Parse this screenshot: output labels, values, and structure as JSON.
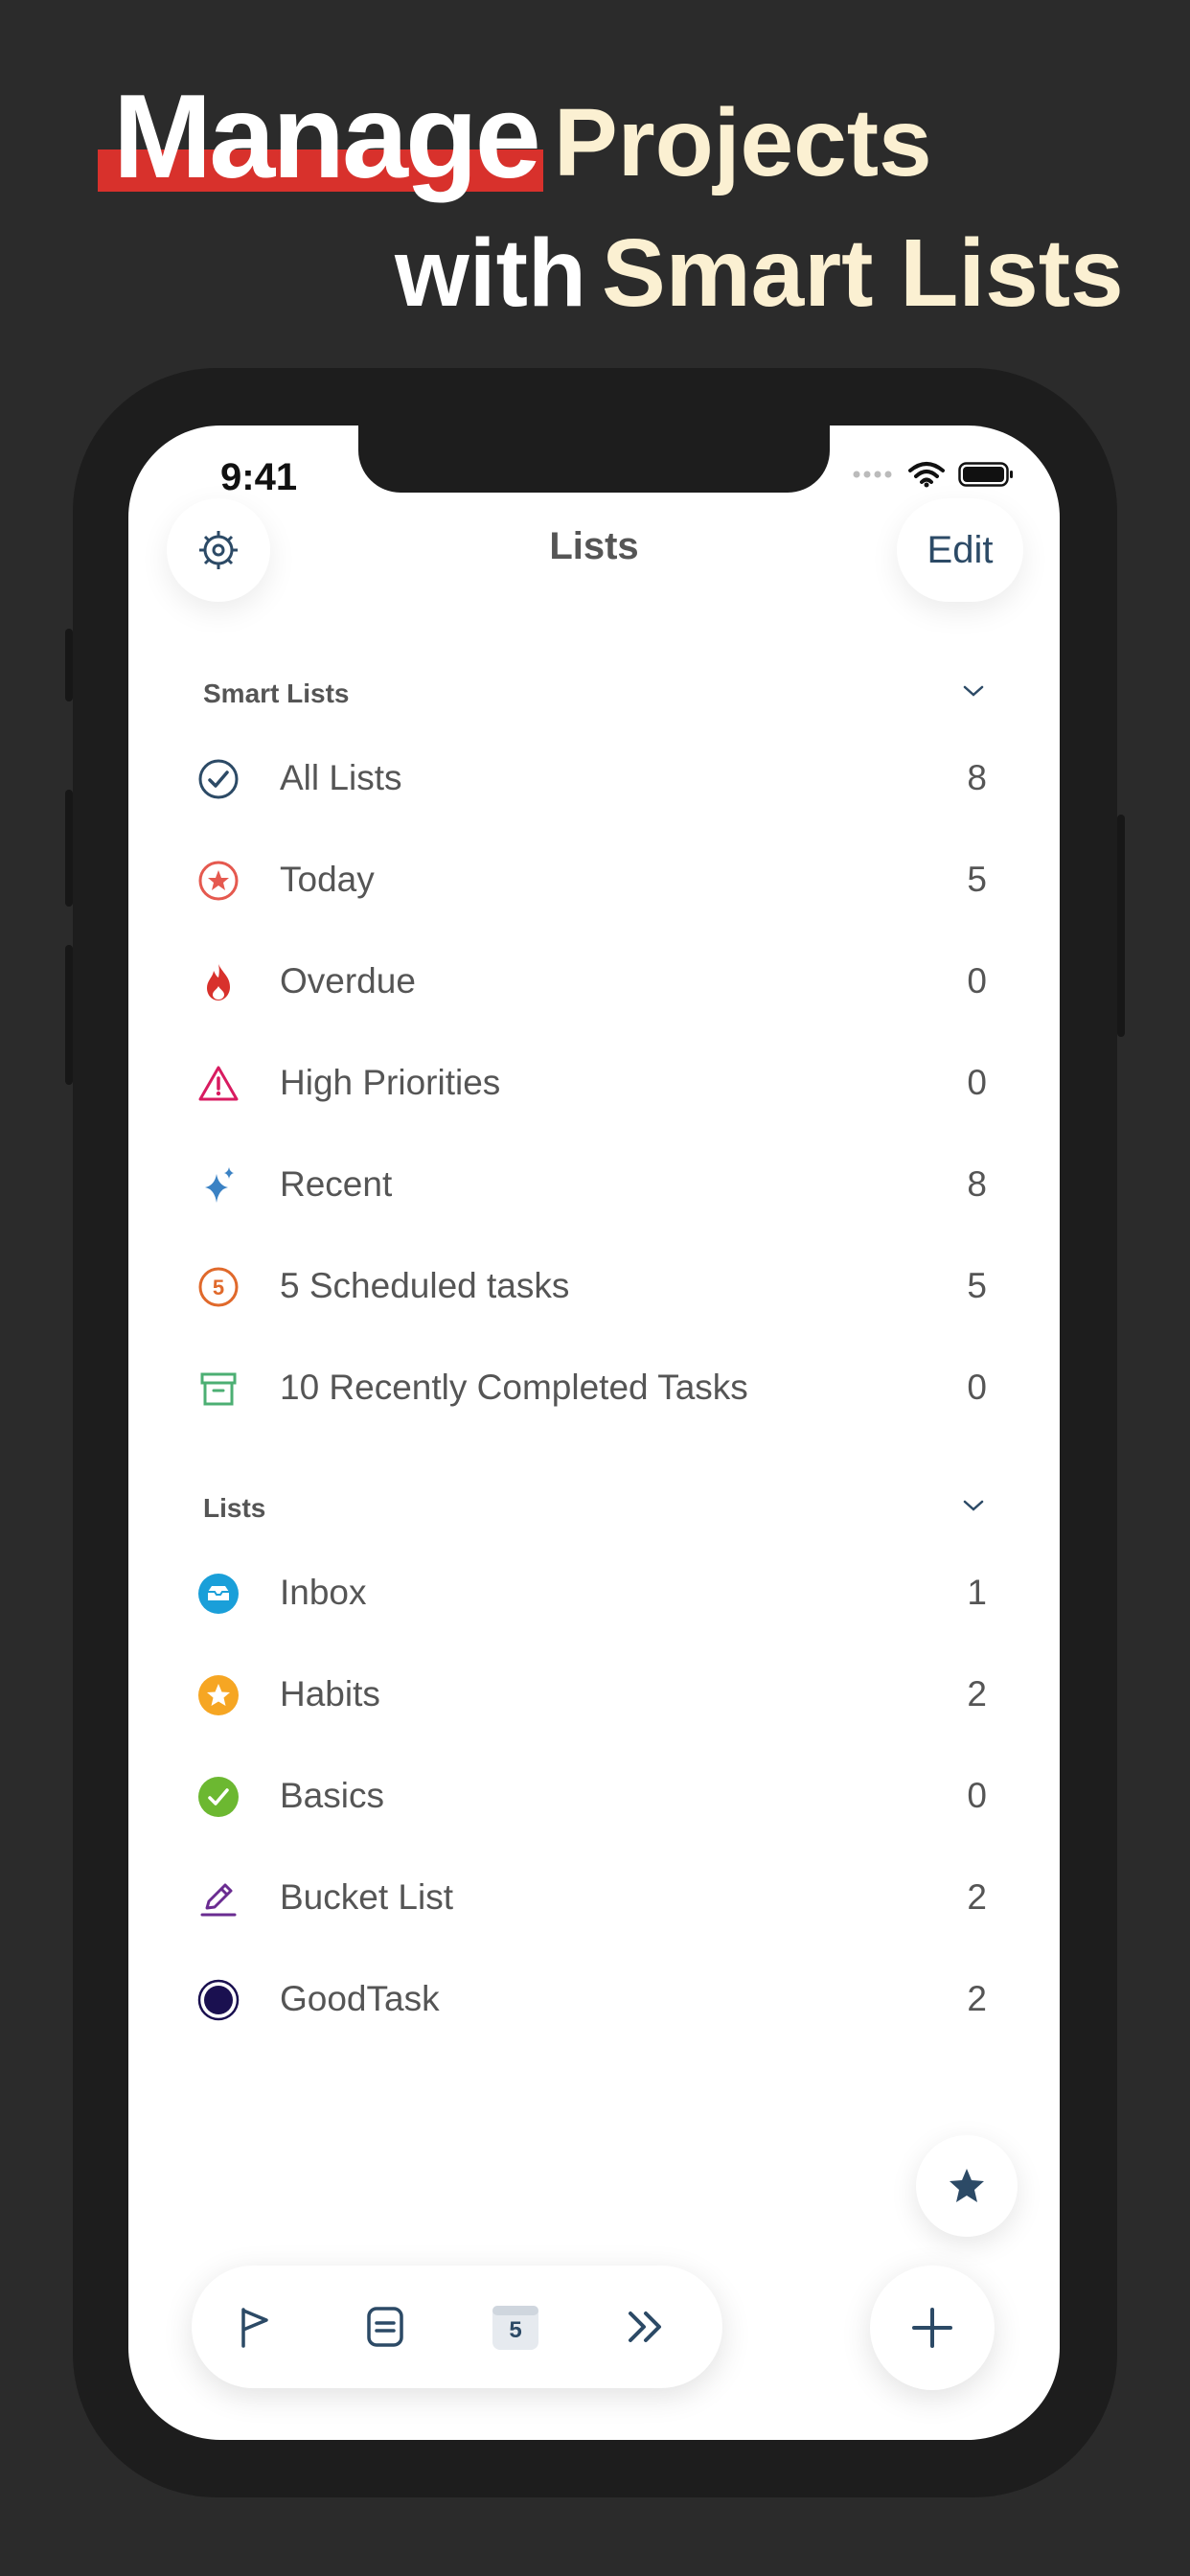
{
  "headline": {
    "word1": "Manage",
    "word2": "Projects",
    "word3": "with",
    "word4": "Smart Lists"
  },
  "status_bar": {
    "time": "9:41"
  },
  "nav": {
    "title": "Lists",
    "edit_label": "Edit"
  },
  "smart_lists": {
    "header": "Smart Lists",
    "items": [
      {
        "label": "All Lists",
        "count": "8",
        "icon": "checkmark-circle-icon",
        "color": "#2c4a66"
      },
      {
        "label": "Today",
        "count": "5",
        "icon": "star-circle-icon",
        "color": "#e5594f"
      },
      {
        "label": "Overdue",
        "count": "0",
        "icon": "flame-icon",
        "color": "#d8312c"
      },
      {
        "label": "High Priorities",
        "count": "0",
        "icon": "warning-triangle-icon",
        "color": "#d81b60"
      },
      {
        "label": "Recent",
        "count": "8",
        "icon": "sparkles-icon",
        "color": "#3b82c4"
      },
      {
        "label": "5 Scheduled tasks",
        "count": "5",
        "icon": "number-circle-icon",
        "color": "#e0692b"
      },
      {
        "label": "10 Recently Completed Tasks",
        "count": "0",
        "icon": "archive-box-icon",
        "color": "#4caf73"
      }
    ]
  },
  "lists": {
    "header": "Lists",
    "items": [
      {
        "label": "Inbox",
        "count": "1",
        "icon": "inbox-icon",
        "color": "#1a9fd9"
      },
      {
        "label": "Habits",
        "count": "2",
        "icon": "star-circle-icon",
        "color": "#f6a623"
      },
      {
        "label": "Basics",
        "count": "0",
        "icon": "checkmark-circle-icon",
        "color": "#6cb831"
      },
      {
        "label": "Bucket List",
        "count": "2",
        "icon": "pencil-icon",
        "color": "#6a2c91"
      },
      {
        "label": "GoodTask",
        "count": "2",
        "icon": "dot-circle-icon",
        "color": "#1a1050"
      }
    ]
  },
  "toolbar": {
    "calendar_day": "5"
  }
}
